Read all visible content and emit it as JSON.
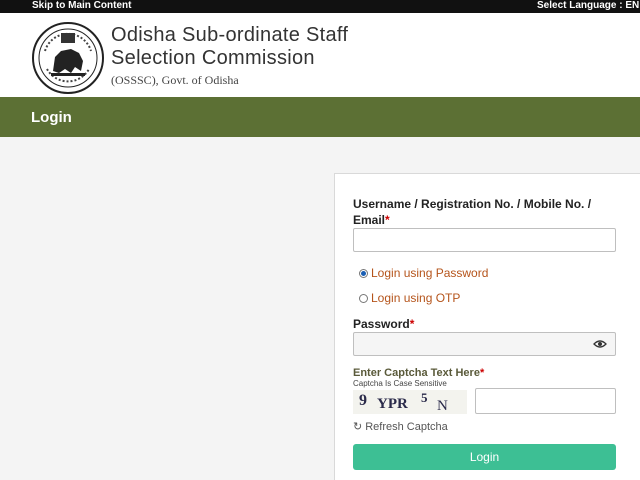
{
  "topbar": {
    "skip_link": "Skip to Main Content",
    "language_label": "Select Language :  EN"
  },
  "header": {
    "org_name_line1": "Odisha Sub-ordinate Staff",
    "org_name_line2": "Selection Commission",
    "org_subtitle": "(OSSSC), Govt. of Odisha",
    "emblem_icon": "odisha-state-emblem-icon"
  },
  "titlebar": {
    "title": "Login"
  },
  "form": {
    "username_label": "Username / Registration No. / Mobile No. /",
    "username_label2": "Email",
    "required_mark": "*",
    "username_value": "",
    "login_mode_options": [
      "Login using Password",
      "Login using OTP"
    ],
    "login_mode_selected": "Login using Password",
    "password_label": "Password",
    "password_value": "",
    "password_toggle_icon": "eye-icon",
    "captcha_label": "Enter Captcha Text Here",
    "captcha_note": "Captcha Is Case Sensitive",
    "captcha_text": "9 YPR5 N",
    "captcha_value": "",
    "refresh_label": "Refresh Captcha",
    "refresh_icon": "refresh-icon",
    "login_button": "Login"
  },
  "colors": {
    "title_bar": "#5c7034",
    "login_button": "#3dbf94",
    "radio_label": "#b5541b",
    "required": "#cc0000"
  }
}
